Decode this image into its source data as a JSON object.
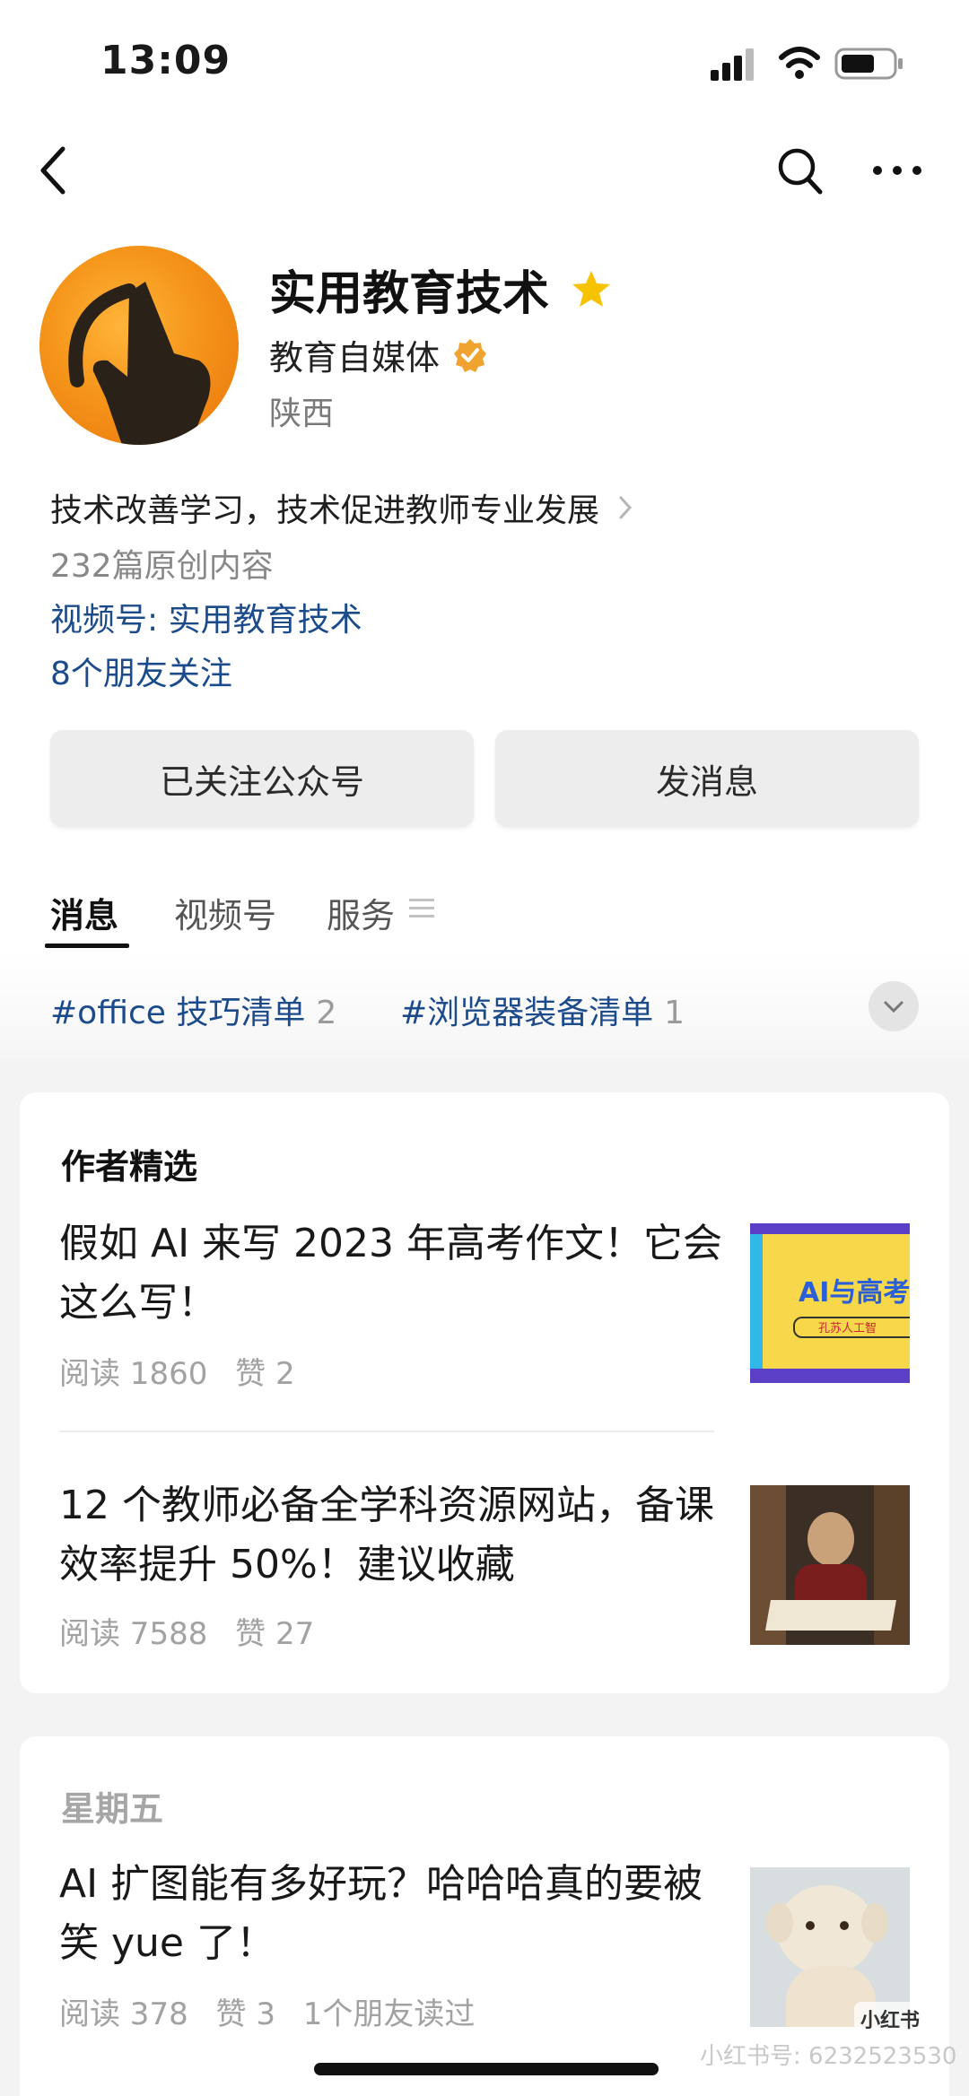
{
  "status_bar": {
    "time": "13:09",
    "icons": [
      "signal-icon",
      "wifi-icon",
      "battery-icon"
    ]
  },
  "nav": {
    "back_icon": "back-arrow-icon",
    "search_icon": "search-icon",
    "more_icon": "more-dots-icon"
  },
  "profile": {
    "name": "实用教育技术",
    "subtitle": "教育自媒体",
    "region": "陕西",
    "description": "技术改善学习，技术促进教师专业发展",
    "original_count": "232篇原创内容",
    "video_channel": "视频号: 实用教育技术",
    "friends_following": "8个朋友关注",
    "colors": {
      "accent_link": "#1c4b8c",
      "avatar_orange": "#f5951a",
      "star_yellow": "#f7c300",
      "verify_orange": "#f0a32e"
    }
  },
  "buttons": {
    "follow": "已关注公众号",
    "message": "发消息"
  },
  "tabs": [
    {
      "label": "消息",
      "active": true
    },
    {
      "label": "视频号",
      "active": false
    },
    {
      "label": "服务",
      "active": false
    }
  ],
  "hashtags": [
    {
      "label": "#office 技巧清单",
      "count": "2"
    },
    {
      "label": "#浏览器装备清单",
      "count": "1"
    }
  ],
  "featured": {
    "section_title": "作者精选",
    "articles": [
      {
        "title": "假如 AI 来写 2023 年高考作文！它会这么写！",
        "reads": "阅读 1860",
        "likes": "赞 2",
        "thumb_text": "AI与高考",
        "thumb_sub": "孔苏人工智"
      },
      {
        "title": "12 个教师必备全学科资源网站，备课效率提升 50%！建议收藏",
        "reads": "阅读 7588",
        "likes": "赞 27"
      }
    ]
  },
  "recent": {
    "weekday": "星期五",
    "articles": [
      {
        "title": "AI 扩图能有多好玩？哈哈哈真的要被笑 yue 了！",
        "reads": "阅读 378",
        "likes": "赞 3",
        "friends": "1个朋友读过"
      }
    ]
  },
  "watermark": {
    "badge": "小红书",
    "text": "小红书号: 6232523530"
  }
}
